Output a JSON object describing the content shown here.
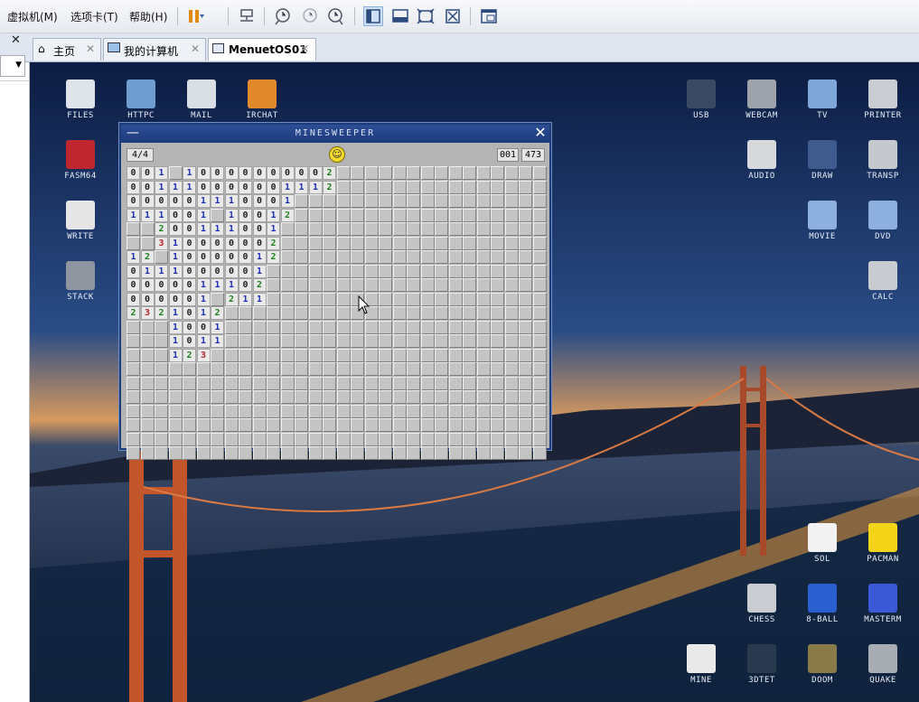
{
  "menu": {
    "vm": "虚拟机(M)",
    "tabs": "选项卡(T)",
    "help": "帮助(H)"
  },
  "vmtabs": [
    {
      "label": "主页"
    },
    {
      "label": "我的计算机"
    },
    {
      "label": "MenuetOS01"
    }
  ],
  "colors": {
    "n1": "#1d2fb5",
    "n2": "#1d7f1d",
    "n3": "#b42424",
    "n0": "#222222"
  },
  "desktop_icons": [
    {
      "label": "FILES",
      "icon": "files-icon",
      "c": "#dfe3ea"
    },
    {
      "label": "HTTPC",
      "icon": "globe-icon",
      "c": "#6f9dd1"
    },
    {
      "label": "MAIL",
      "icon": "mail-icon",
      "c": "#d9dde4"
    },
    {
      "label": "IRCHAT",
      "icon": "chat-icon",
      "c": "#e08a2c"
    },
    {
      "label": "FASM64",
      "icon": "fasm-icon",
      "c": "#c0262e"
    },
    {
      "label": "WRITE",
      "icon": "write-icon",
      "c": "#e6e6e6"
    },
    {
      "label": "STACK",
      "icon": "tools-icon",
      "c": "#8f959e"
    },
    {
      "label": "USB",
      "icon": "usb-icon",
      "c": "#3b4863"
    },
    {
      "label": "WEBCAM",
      "icon": "webcam-icon",
      "c": "#9ea3ab"
    },
    {
      "label": "TV",
      "icon": "tv-icon",
      "c": "#7fa6d8"
    },
    {
      "label": "PRINTER",
      "icon": "printer-icon",
      "c": "#c9ccd1"
    },
    {
      "label": "AUDIO",
      "icon": "play-icon",
      "c": "#d6d8dc"
    },
    {
      "label": "DRAW",
      "icon": "draw-icon",
      "c": "#3f5a8c"
    },
    {
      "label": "TRANSP",
      "icon": "transp-icon",
      "c": "#c5c8cc"
    },
    {
      "label": "MOVIE",
      "icon": "movie-icon",
      "c": "#8db0de"
    },
    {
      "label": "DVD",
      "icon": "dvd-icon",
      "c": "#8db0de"
    },
    {
      "label": "CALC",
      "icon": "calc-icon",
      "c": "#c8cbd0"
    },
    {
      "label": "SOL",
      "icon": "dice-icon",
      "c": "#f2f2f2"
    },
    {
      "label": "PACMAN",
      "icon": "pacman-icon",
      "c": "#f3d419"
    },
    {
      "label": "CHESS",
      "icon": "chess-knight-icon",
      "c": "#c9ccd1"
    },
    {
      "label": "8-BALL",
      "icon": "pool-icon",
      "c": "#2a5fd0"
    },
    {
      "label": "MASTERM",
      "icon": "mastermind-icon",
      "c": "#3b59d6"
    },
    {
      "label": "MINE",
      "icon": "mine-icon",
      "c": "#e9e9e9"
    },
    {
      "label": "3DTET",
      "icon": "tetris-icon",
      "c": "#2a3a4e"
    },
    {
      "label": "DOOM",
      "icon": "doom-icon",
      "c": "#8a7a4a"
    },
    {
      "label": "QUAKE",
      "icon": "quake-icon",
      "c": "#a8acb3"
    }
  ],
  "minesweeper": {
    "title": "MINESWEEPER",
    "level": "4/4",
    "mines": "001",
    "time": "473",
    "cols": 30,
    "rows": 21,
    "revealed": [
      [
        0,
        0,
        "0"
      ],
      [
        1,
        0,
        "0"
      ],
      [
        2,
        0,
        "1"
      ],
      [
        4,
        0,
        "1"
      ],
      [
        5,
        0,
        "0"
      ],
      [
        6,
        0,
        "0"
      ],
      [
        7,
        0,
        "0"
      ],
      [
        8,
        0,
        "0"
      ],
      [
        9,
        0,
        "0"
      ],
      [
        10,
        0,
        "0"
      ],
      [
        11,
        0,
        "0"
      ],
      [
        12,
        0,
        "0"
      ],
      [
        13,
        0,
        "0"
      ],
      [
        14,
        0,
        "2"
      ],
      [
        0,
        1,
        "0"
      ],
      [
        1,
        1,
        "0"
      ],
      [
        2,
        1,
        "1"
      ],
      [
        3,
        1,
        "1"
      ],
      [
        4,
        1,
        "1"
      ],
      [
        5,
        1,
        "0"
      ],
      [
        6,
        1,
        "0"
      ],
      [
        7,
        1,
        "0"
      ],
      [
        8,
        1,
        "0"
      ],
      [
        9,
        1,
        "0"
      ],
      [
        10,
        1,
        "0"
      ],
      [
        11,
        1,
        "1"
      ],
      [
        12,
        1,
        "1"
      ],
      [
        13,
        1,
        "1"
      ],
      [
        14,
        1,
        "2"
      ],
      [
        0,
        2,
        "0"
      ],
      [
        1,
        2,
        "0"
      ],
      [
        2,
        2,
        "0"
      ],
      [
        3,
        2,
        "0"
      ],
      [
        4,
        2,
        "0"
      ],
      [
        5,
        2,
        "1"
      ],
      [
        6,
        2,
        "1"
      ],
      [
        7,
        2,
        "1"
      ],
      [
        8,
        2,
        "0"
      ],
      [
        9,
        2,
        "0"
      ],
      [
        10,
        2,
        "0"
      ],
      [
        11,
        2,
        "1"
      ],
      [
        0,
        3,
        "1"
      ],
      [
        1,
        3,
        "1"
      ],
      [
        2,
        3,
        "1"
      ],
      [
        3,
        3,
        "0"
      ],
      [
        4,
        3,
        "0"
      ],
      [
        5,
        3,
        "1"
      ],
      [
        7,
        3,
        "1"
      ],
      [
        8,
        3,
        "0"
      ],
      [
        9,
        3,
        "0"
      ],
      [
        10,
        3,
        "1"
      ],
      [
        11,
        3,
        "2"
      ],
      [
        2,
        4,
        "2"
      ],
      [
        3,
        4,
        "0"
      ],
      [
        4,
        4,
        "0"
      ],
      [
        5,
        4,
        "1"
      ],
      [
        6,
        4,
        "1"
      ],
      [
        7,
        4,
        "1"
      ],
      [
        8,
        4,
        "0"
      ],
      [
        9,
        4,
        "0"
      ],
      [
        10,
        4,
        "1"
      ],
      [
        2,
        5,
        "3"
      ],
      [
        3,
        5,
        "1"
      ],
      [
        4,
        5,
        "0"
      ],
      [
        5,
        5,
        "0"
      ],
      [
        6,
        5,
        "0"
      ],
      [
        7,
        5,
        "0"
      ],
      [
        8,
        5,
        "0"
      ],
      [
        9,
        5,
        "0"
      ],
      [
        10,
        5,
        "2"
      ],
      [
        0,
        6,
        "1"
      ],
      [
        1,
        6,
        "2"
      ],
      [
        3,
        6,
        "1"
      ],
      [
        4,
        6,
        "0"
      ],
      [
        5,
        6,
        "0"
      ],
      [
        6,
        6,
        "0"
      ],
      [
        7,
        6,
        "0"
      ],
      [
        8,
        6,
        "0"
      ],
      [
        9,
        6,
        "1"
      ],
      [
        10,
        6,
        "2"
      ],
      [
        0,
        7,
        "0"
      ],
      [
        1,
        7,
        "1"
      ],
      [
        2,
        7,
        "1"
      ],
      [
        3,
        7,
        "1"
      ],
      [
        4,
        7,
        "0"
      ],
      [
        5,
        7,
        "0"
      ],
      [
        6,
        7,
        "0"
      ],
      [
        7,
        7,
        "0"
      ],
      [
        8,
        7,
        "0"
      ],
      [
        9,
        7,
        "1"
      ],
      [
        0,
        8,
        "0"
      ],
      [
        1,
        8,
        "0"
      ],
      [
        2,
        8,
        "0"
      ],
      [
        3,
        8,
        "0"
      ],
      [
        4,
        8,
        "0"
      ],
      [
        5,
        8,
        "1"
      ],
      [
        6,
        8,
        "1"
      ],
      [
        7,
        8,
        "1"
      ],
      [
        8,
        8,
        "0"
      ],
      [
        9,
        8,
        "2"
      ],
      [
        0,
        9,
        "0"
      ],
      [
        1,
        9,
        "0"
      ],
      [
        2,
        9,
        "0"
      ],
      [
        3,
        9,
        "0"
      ],
      [
        4,
        9,
        "0"
      ],
      [
        5,
        9,
        "1"
      ],
      [
        7,
        9,
        "2"
      ],
      [
        8,
        9,
        "1"
      ],
      [
        9,
        9,
        "1"
      ],
      [
        0,
        10,
        "2"
      ],
      [
        1,
        10,
        "3"
      ],
      [
        2,
        10,
        "2"
      ],
      [
        3,
        10,
        "1"
      ],
      [
        4,
        10,
        "0"
      ],
      [
        5,
        10,
        "1"
      ],
      [
        6,
        10,
        "2"
      ],
      [
        3,
        11,
        "1"
      ],
      [
        4,
        11,
        "0"
      ],
      [
        5,
        11,
        "0"
      ],
      [
        6,
        11,
        "1"
      ],
      [
        3,
        12,
        "1"
      ],
      [
        4,
        12,
        "0"
      ],
      [
        5,
        12,
        "1"
      ],
      [
        6,
        12,
        "1"
      ],
      [
        3,
        13,
        "1"
      ],
      [
        4,
        13,
        "2"
      ],
      [
        5,
        13,
        "3"
      ]
    ]
  }
}
